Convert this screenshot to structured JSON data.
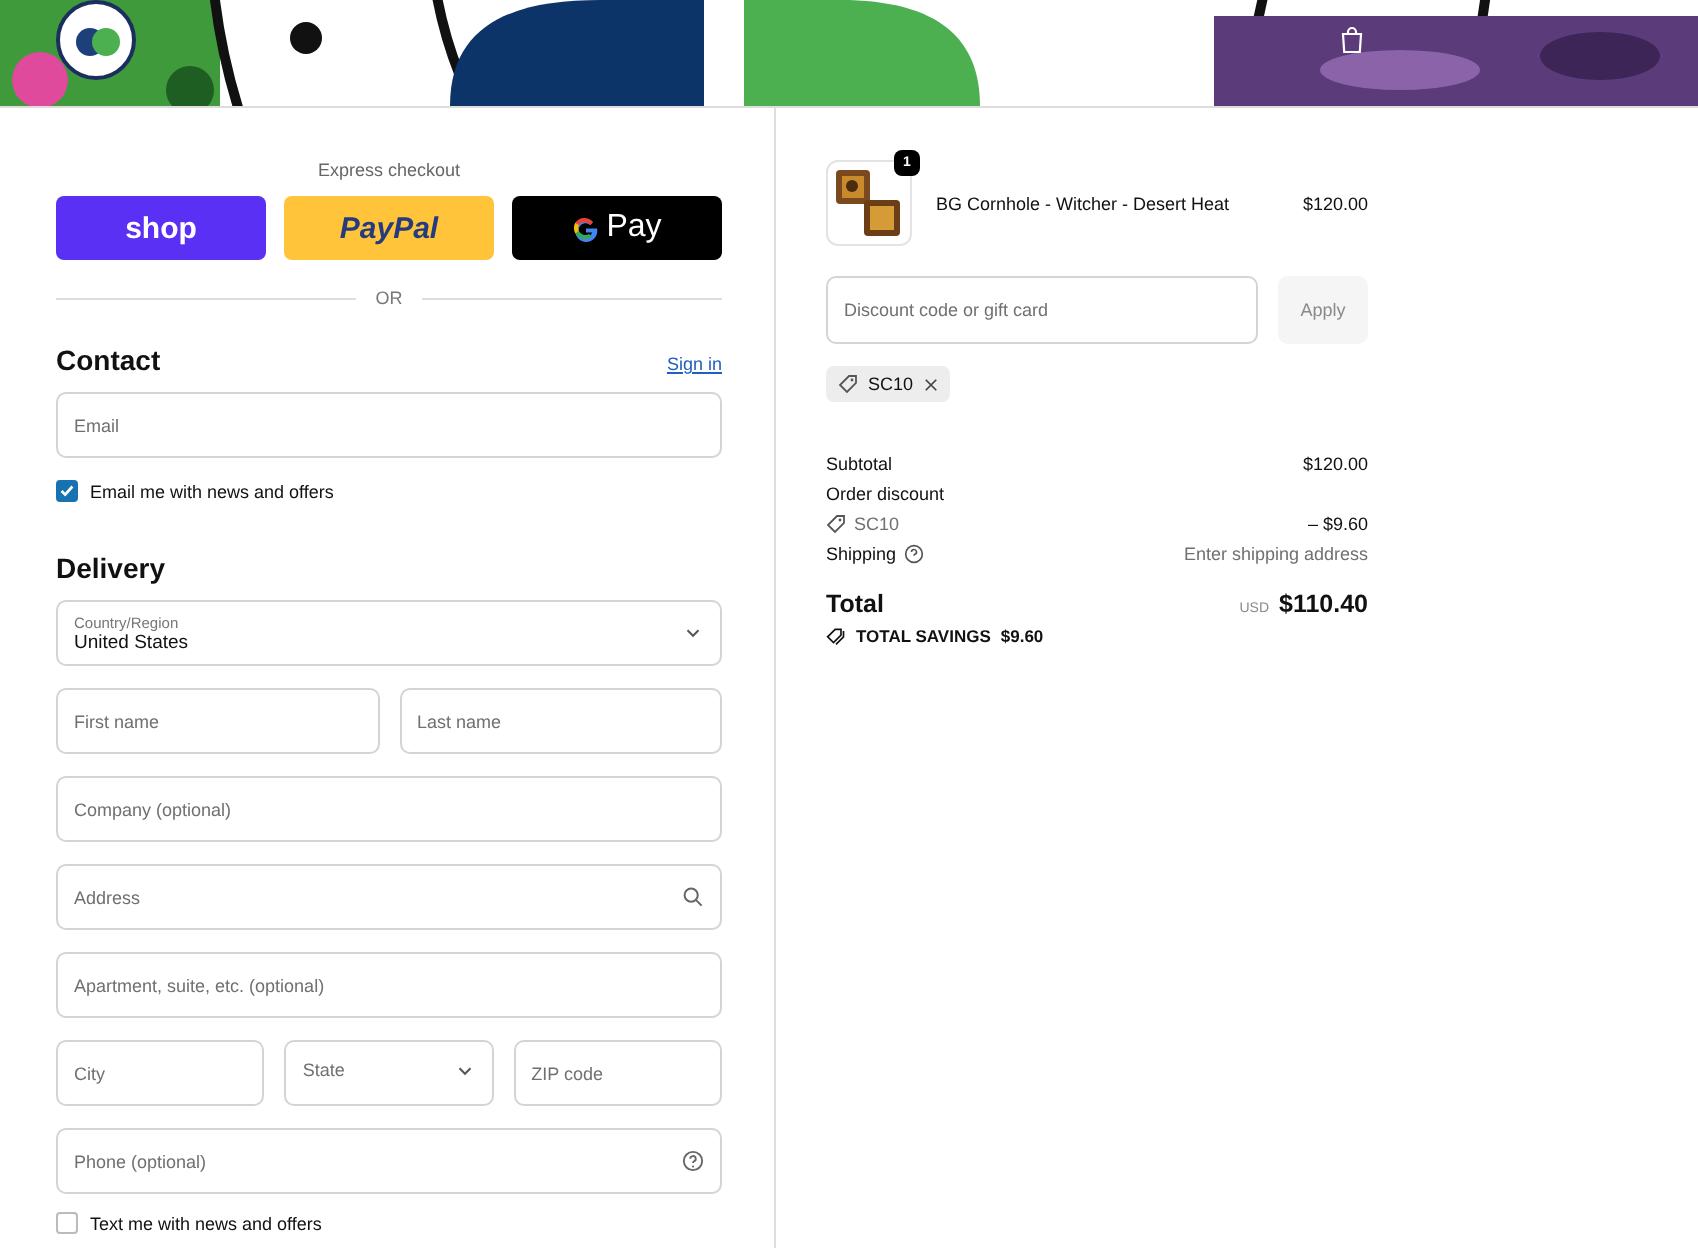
{
  "express_checkout": {
    "heading": "Express checkout",
    "buttons": [
      {
        "kind": "shop",
        "label": "shop"
      },
      {
        "kind": "paypal",
        "label": "PayPal"
      },
      {
        "kind": "gpay",
        "label": "Pay"
      }
    ]
  },
  "divider": "OR",
  "contact": {
    "heading": "Contact",
    "sign_in": "Sign in",
    "email": {
      "placeholder": "Email"
    },
    "newsletter": {
      "label": "Email me with news and offers",
      "checked": true
    }
  },
  "delivery": {
    "heading": "Delivery",
    "country": {
      "label": "Country/Region",
      "value": "United States"
    },
    "rows": [
      [
        {
          "kind": "text",
          "placeholder": "First name"
        },
        {
          "kind": "text",
          "placeholder": "Last name"
        }
      ],
      [
        {
          "kind": "text",
          "placeholder": "Company (optional)"
        }
      ],
      [
        {
          "kind": "search",
          "placeholder": "Address"
        }
      ],
      [
        {
          "kind": "text",
          "placeholder": "Apartment, suite, etc. (optional)"
        }
      ],
      [
        {
          "kind": "text",
          "placeholder": "City"
        },
        {
          "kind": "select",
          "placeholder": "State"
        },
        {
          "kind": "text",
          "placeholder": "ZIP code"
        }
      ],
      [
        {
          "kind": "help",
          "placeholder": "Phone (optional)"
        }
      ]
    ],
    "sms": {
      "label": "Text me with news and offers",
      "checked": false
    }
  },
  "summary": {
    "items": [
      {
        "name": "BG Cornhole - Witcher - Desert Heat",
        "price": "$120.00",
        "quantity": "1"
      }
    ],
    "discount": {
      "placeholder": "Discount code or gift card",
      "button": "Apply",
      "disabled": true
    },
    "applied_codes": [
      {
        "code": "SC10"
      }
    ],
    "lines": [
      {
        "kind": "plain",
        "label": "Subtotal",
        "value": "$120.00"
      },
      {
        "kind": "heading",
        "label": "Order discount"
      },
      {
        "kind": "code",
        "label": "SC10",
        "value": "– $9.60"
      },
      {
        "kind": "help",
        "label": "Shipping",
        "value": "Enter shipping address"
      }
    ],
    "total": {
      "label": "Total",
      "currency": "USD",
      "amount": "$110.40"
    },
    "savings": {
      "label": "TOTAL SAVINGS",
      "amount": "$9.60"
    }
  }
}
